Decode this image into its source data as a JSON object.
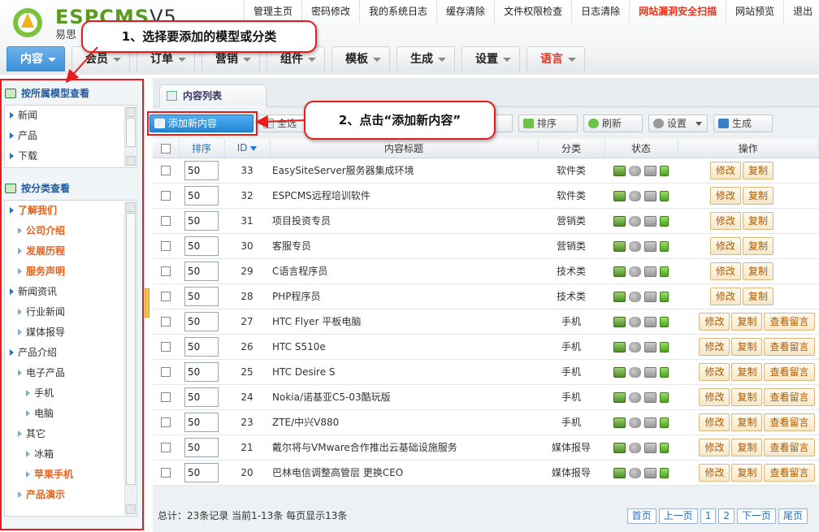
{
  "logo": {
    "text": "ESPCMS",
    "version": "V5",
    "sub": "易思"
  },
  "topnav": [
    {
      "label": "管理主页",
      "red": false
    },
    {
      "label": "密码修改",
      "red": false
    },
    {
      "label": "我的系统日志",
      "red": false
    },
    {
      "label": "缓存清除",
      "red": false
    },
    {
      "label": "文件权限检查",
      "red": false
    },
    {
      "label": "日志清除",
      "red": false
    },
    {
      "label": "网站漏洞安全扫描",
      "red": true
    },
    {
      "label": "网站预览",
      "red": false
    },
    {
      "label": "退出",
      "red": false
    }
  ],
  "mainnav": [
    {
      "label": "内容",
      "active": true,
      "red": false
    },
    {
      "label": "会员",
      "active": false,
      "red": false
    },
    {
      "label": "订单",
      "active": false,
      "red": false
    },
    {
      "label": "营销",
      "active": false,
      "red": false
    },
    {
      "label": "组件",
      "active": false,
      "red": false
    },
    {
      "label": "模板",
      "active": false,
      "red": false
    },
    {
      "label": "生成",
      "active": false,
      "red": false
    },
    {
      "label": "设置",
      "active": false,
      "red": false
    },
    {
      "label": "语言",
      "active": false,
      "red": true
    }
  ],
  "sidebar": {
    "model_title": "按所属模型查看",
    "models": [
      "新闻",
      "产品",
      "下载"
    ],
    "cat_title": "按分类查看",
    "categories": [
      {
        "label": "了解我们",
        "level": 0,
        "orange": true,
        "hollow": false
      },
      {
        "label": "公司介绍",
        "level": 1,
        "orange": true,
        "hollow": true
      },
      {
        "label": "发展历程",
        "level": 1,
        "orange": true,
        "hollow": true
      },
      {
        "label": "服务声明",
        "level": 1,
        "orange": true,
        "hollow": true
      },
      {
        "label": "新闻资讯",
        "level": 0,
        "orange": false,
        "hollow": false
      },
      {
        "label": "行业新闻",
        "level": 1,
        "orange": false,
        "hollow": true
      },
      {
        "label": "媒体报导",
        "level": 1,
        "orange": false,
        "hollow": true
      },
      {
        "label": "产品介绍",
        "level": 0,
        "orange": false,
        "hollow": false
      },
      {
        "label": "电子产品",
        "level": 1,
        "orange": false,
        "hollow": true
      },
      {
        "label": "手机",
        "level": 2,
        "orange": false,
        "hollow": true
      },
      {
        "label": "电脑",
        "level": 2,
        "orange": false,
        "hollow": true
      },
      {
        "label": "其它",
        "level": 1,
        "orange": false,
        "hollow": true
      },
      {
        "label": "冰箱",
        "level": 2,
        "orange": false,
        "hollow": true
      },
      {
        "label": "苹果手机",
        "level": 2,
        "orange": true,
        "hollow": true
      },
      {
        "label": "产品演示",
        "level": 1,
        "orange": true,
        "hollow": true
      }
    ]
  },
  "tab": {
    "label": "内容列表"
  },
  "toolbar": {
    "add": "添加新内容",
    "select_all": "全选",
    "sort": "排序",
    "refresh": "刷新",
    "settings": "设置",
    "generate": "生成"
  },
  "table": {
    "headers": {
      "sort": "排序",
      "id": "ID",
      "title": "内容标题",
      "category": "分类",
      "status": "状态",
      "ops": "操作"
    },
    "rows": [
      {
        "sort": "50",
        "id": "33",
        "title": "EasySiteServer服务器集成环境",
        "category": "软件类",
        "ops": [
          "修改",
          "复制"
        ]
      },
      {
        "sort": "50",
        "id": "32",
        "title": "ESPCMS远程培训软件",
        "category": "软件类",
        "ops": [
          "修改",
          "复制"
        ]
      },
      {
        "sort": "50",
        "id": "31",
        "title": "项目投资专员",
        "category": "营销类",
        "ops": [
          "修改",
          "复制"
        ]
      },
      {
        "sort": "50",
        "id": "30",
        "title": "客服专员",
        "category": "营销类",
        "ops": [
          "修改",
          "复制"
        ]
      },
      {
        "sort": "50",
        "id": "29",
        "title": "C语言程序员",
        "category": "技术类",
        "ops": [
          "修改",
          "复制"
        ]
      },
      {
        "sort": "50",
        "id": "28",
        "title": "PHP程序员",
        "category": "技术类",
        "ops": [
          "修改",
          "复制"
        ]
      },
      {
        "sort": "50",
        "id": "27",
        "title": "HTC Flyer 平板电脑",
        "category": "手机",
        "ops": [
          "修改",
          "复制",
          "查看留言"
        ]
      },
      {
        "sort": "50",
        "id": "26",
        "title": "HTC S510e",
        "category": "手机",
        "ops": [
          "修改",
          "复制",
          "查看留言"
        ]
      },
      {
        "sort": "50",
        "id": "25",
        "title": "HTC Desire S",
        "category": "手机",
        "ops": [
          "修改",
          "复制",
          "查看留言"
        ]
      },
      {
        "sort": "50",
        "id": "24",
        "title": "Nokia/诺基亚C5-03酷玩版",
        "category": "手机",
        "ops": [
          "修改",
          "复制",
          "查看留言"
        ]
      },
      {
        "sort": "50",
        "id": "23",
        "title": "ZTE/中兴V880",
        "category": "手机",
        "ops": [
          "修改",
          "复制",
          "查看留言"
        ]
      },
      {
        "sort": "50",
        "id": "21",
        "title": "戴尔将与VMware合作推出云基础设施服务",
        "category": "媒体报导",
        "ops": [
          "修改",
          "复制",
          "查看留言"
        ]
      },
      {
        "sort": "50",
        "id": "20",
        "title": "巴林电信调整高管层 更换CEO",
        "category": "媒体报导",
        "ops": [
          "修改",
          "复制",
          "查看留言"
        ]
      }
    ]
  },
  "footer": {
    "summary": "总计：23条记录 当前1-13条 每页显示13条",
    "pager": [
      "首页",
      "上一页",
      "1",
      "2",
      "下一页",
      "尾页"
    ]
  },
  "annotations": {
    "step1": "1、选择要添加的模型或分类",
    "step2": "2、点击“添加新内容”"
  }
}
